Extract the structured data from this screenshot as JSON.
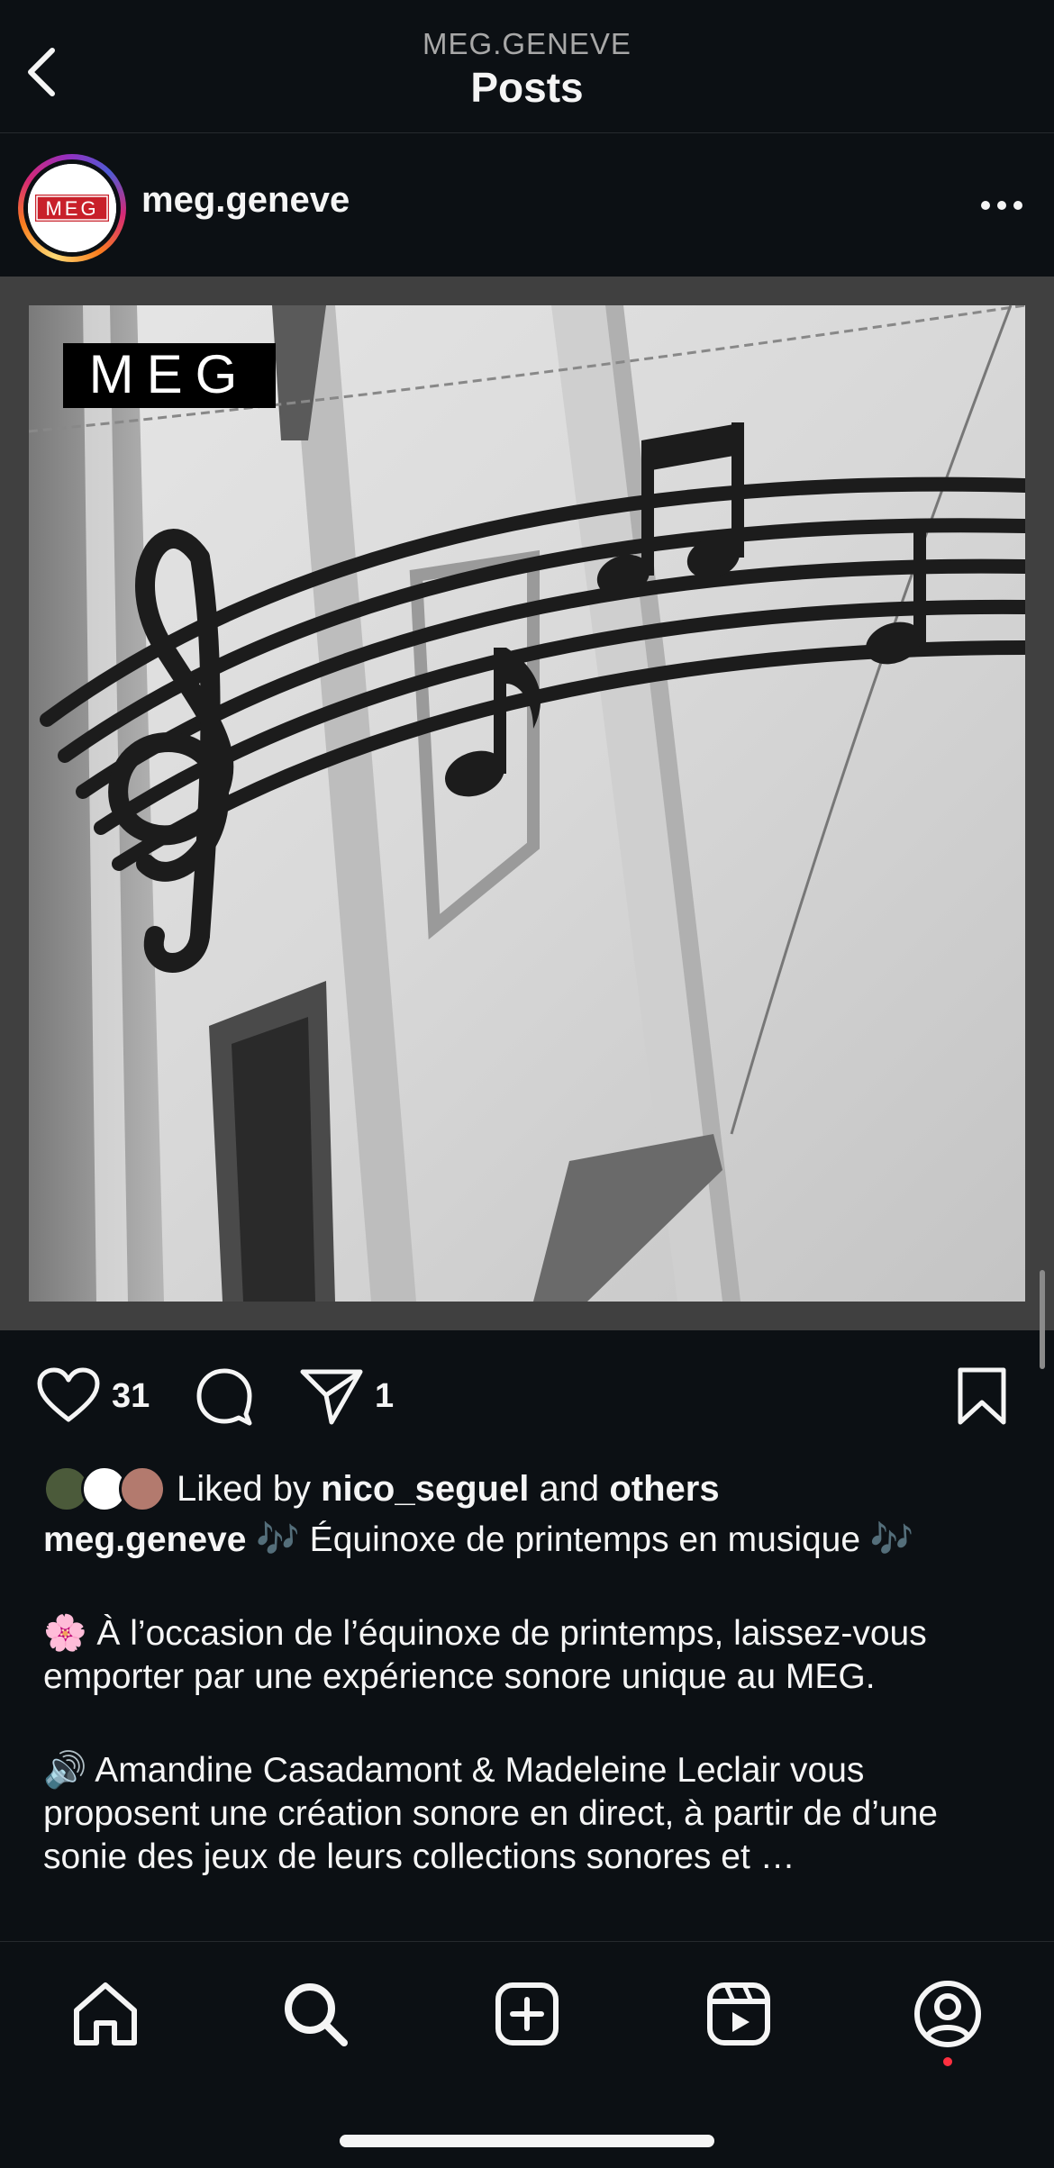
{
  "header": {
    "account": "MEG.GENEVE",
    "title": "Posts"
  },
  "post": {
    "username": "meg.geneve",
    "avatar_logo": "MEG",
    "image_logo": "MEG",
    "likes": "31",
    "shares": "1",
    "liked_by": {
      "prefix": "Liked by",
      "user": "nico_seguel",
      "and": "and",
      "others": "others"
    },
    "caption": {
      "username": "meg.geneve",
      "title": "🎶 Équinoxe de printemps en musique 🎶",
      "p1": "🌸 À l’occasion de l’équinoxe de printemps, laissez-vous emporter par une expérience sonore unique au MEG.",
      "p2": "🔊 Amandine Casadamont & Madeleine Leclair vous proposent une création sonore en direct, à partir de d’une sonie des jeux de leurs collections sonores et …"
    }
  },
  "icons": {
    "back": "chevron-left-icon",
    "more": "more-horizontal-icon",
    "like": "heart-icon",
    "comment": "comment-icon",
    "share": "send-icon",
    "save": "bookmark-icon",
    "nav": [
      "home-icon",
      "search-icon",
      "create-icon",
      "reels-icon",
      "profile-icon"
    ]
  },
  "colors": {
    "background": "#0c1014",
    "text": "#f5f5f5",
    "muted": "#a8a8a8",
    "notification": "#ff3040"
  }
}
